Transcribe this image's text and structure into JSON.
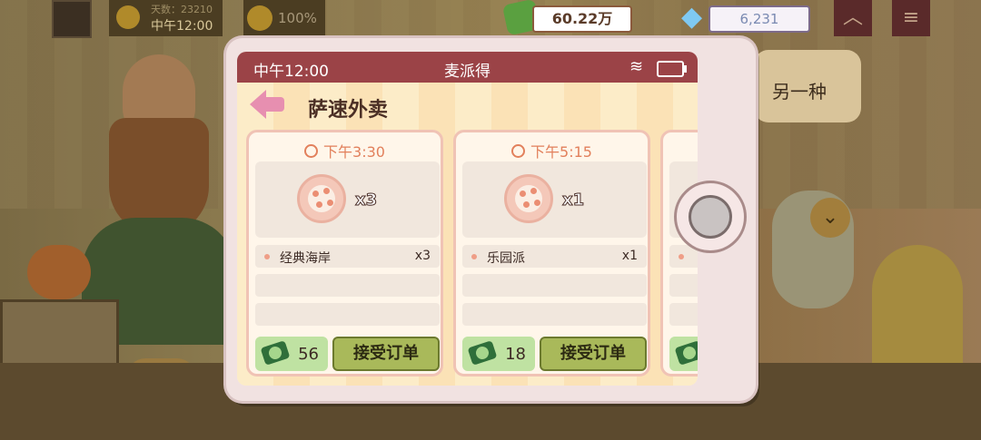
{
  "hud": {
    "day_label": "天数：23210",
    "clock": "中午12:00",
    "mood": "100%",
    "cash": "60.22万",
    "gems": "6,231"
  },
  "speech": "另一种",
  "phone": {
    "status_time": "中午12:00",
    "app_title": "麦派得",
    "page_title": "萨速外卖",
    "orders": [
      {
        "due": "下午3:30",
        "preview_qty": "x3",
        "items": [
          {
            "name": "经典海岸",
            "qty": "x3"
          }
        ],
        "pay": "56",
        "accept_label": "接受订单"
      },
      {
        "due": "下午5:15",
        "preview_qty": "x1",
        "items": [
          {
            "name": "乐园派",
            "qty": "x1"
          }
        ],
        "pay": "18",
        "accept_label": "接受订单"
      }
    ]
  }
}
